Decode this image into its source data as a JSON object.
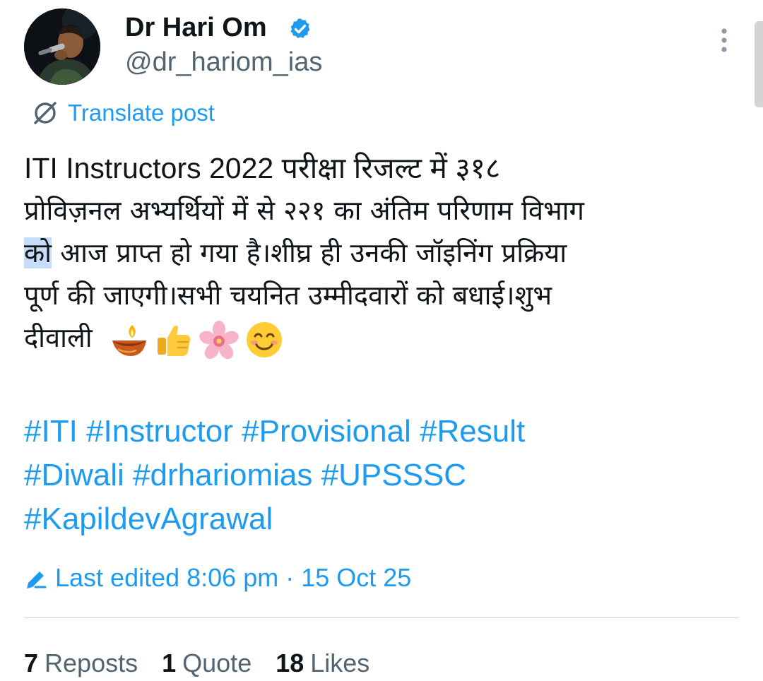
{
  "author": {
    "display_name": "Dr Hari Om",
    "handle": "@dr_hariom_ias",
    "verified": true
  },
  "translate": {
    "label": "Translate post",
    "icon": "translate-icon"
  },
  "post": {
    "lines": [
      "ITI Instructors 2022 परीक्षा रिजल्ट में ३१८",
      "प्रोविज़नल अभ्यर्थियों में से २२१ का अंतिम परिणाम विभाग",
      {
        "selected": "को",
        "rest": " आज प्राप्त हो गया है।शीघ्र ही उनकी जॉइनिंग प्रक्रिया"
      },
      "पूर्ण की जाएगी।सभी चयनित उम्मीदवारों को बधाई।शुभ",
      "दीवाली"
    ],
    "emojis": [
      "diya-icon",
      "thumbs-up-icon",
      "cherry-blossom-icon",
      "smiling-face-icon"
    ]
  },
  "hashtags": [
    [
      "#ITI",
      "#Instructor",
      "#Provisional",
      "#Result"
    ],
    [
      "#Diwali",
      "#drhariomias",
      "#UPSSSC"
    ],
    [
      "#KapildevAgrawal"
    ]
  ],
  "edit_info": {
    "text": "Last edited 8:06 pm · 15 Oct 25"
  },
  "stats": [
    {
      "count": "7",
      "label": "Reposts"
    },
    {
      "count": "1",
      "label": "Quote"
    },
    {
      "count": "18",
      "label": "Likes"
    }
  ],
  "colors": {
    "accent": "#1d9bf0",
    "text": "#0f1419",
    "secondary": "#536471",
    "selection": "#c5ddf6"
  }
}
